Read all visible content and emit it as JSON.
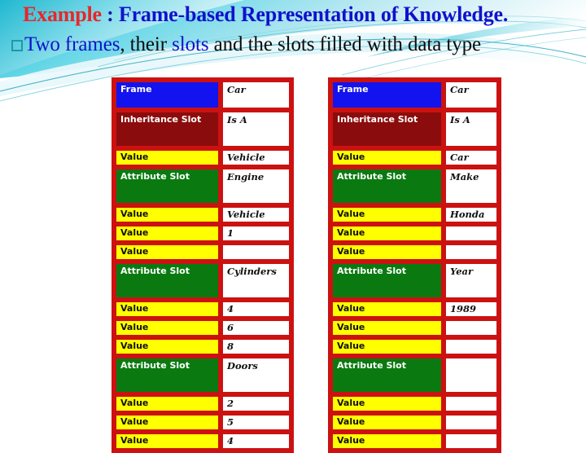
{
  "slide": {
    "heading": {
      "line1": {
        "example": "Example",
        "colon": " : ",
        "topic": "Frame-based Representation of Knowledge."
      },
      "line2": {
        "bullet": "square-bullet",
        "part_blue_1": "Two frames",
        "part_black_1": ", their ",
        "part_blue_2": "slots",
        "part_black_2": " and the slots filled with data type"
      }
    },
    "colors": {
      "example_red": "#e8262a",
      "topic_blue": "#1111cc",
      "text_black": "#0b0b0b",
      "bullet_teal": "#1c9aa8",
      "table_border_red": "#cc1111",
      "frame_blue": "#1313ef",
      "inheritance_dark_red": "#8b0c0c",
      "attribute_green": "#0a7a10",
      "value_yellow": "#ffff00",
      "bg_cyan": "#2ec5dd"
    }
  },
  "tables": [
    {
      "id": "table-left",
      "name": "frame-table-vehicle",
      "rows": [
        {
          "type": "frame",
          "label": "Frame",
          "value": "Car"
        },
        {
          "type": "inheritance",
          "label": "Inheritance Slot",
          "value": "Is A"
        },
        {
          "type": "value",
          "label": "Value",
          "value": "Vehicle"
        },
        {
          "type": "attribute",
          "label": "Attribute Slot",
          "value": "Engine"
        },
        {
          "type": "value",
          "label": "Value",
          "value": "Vehicle"
        },
        {
          "type": "value",
          "label": "Value",
          "value": "1"
        },
        {
          "type": "value",
          "label": "Value",
          "value": ""
        },
        {
          "type": "attribute",
          "label": "Attribute Slot",
          "value": "Cylinders"
        },
        {
          "type": "value",
          "label": "Value",
          "value": "4"
        },
        {
          "type": "value",
          "label": "Value",
          "value": "6"
        },
        {
          "type": "value",
          "label": "Value",
          "value": "8"
        },
        {
          "type": "attribute",
          "label": "Attribute Slot",
          "value": "Doors"
        },
        {
          "type": "value",
          "label": "Value",
          "value": "2"
        },
        {
          "type": "value",
          "label": "Value",
          "value": "5"
        },
        {
          "type": "value",
          "label": "Value",
          "value": "4"
        }
      ]
    },
    {
      "id": "table-right",
      "name": "frame-table-car-instance",
      "rows": [
        {
          "type": "frame",
          "label": "Frame",
          "value": "Car"
        },
        {
          "type": "inheritance",
          "label": "Inheritance Slot",
          "value": "Is A"
        },
        {
          "type": "value",
          "label": "Value",
          "value": "Car"
        },
        {
          "type": "attribute",
          "label": "Attribute Slot",
          "value": "Make"
        },
        {
          "type": "value",
          "label": "Value",
          "value": "Honda"
        },
        {
          "type": "value",
          "label": "Value",
          "value": ""
        },
        {
          "type": "value",
          "label": "Value",
          "value": ""
        },
        {
          "type": "attribute",
          "label": "Attribute Slot",
          "value": "Year"
        },
        {
          "type": "value",
          "label": "Value",
          "value": "1989"
        },
        {
          "type": "value",
          "label": "Value",
          "value": ""
        },
        {
          "type": "value",
          "label": "Value",
          "value": ""
        },
        {
          "type": "attribute",
          "label": "Attribute Slot",
          "value": ""
        },
        {
          "type": "value",
          "label": "Value",
          "value": ""
        },
        {
          "type": "value",
          "label": "Value",
          "value": ""
        },
        {
          "type": "value",
          "label": "Value",
          "value": ""
        }
      ]
    }
  ]
}
